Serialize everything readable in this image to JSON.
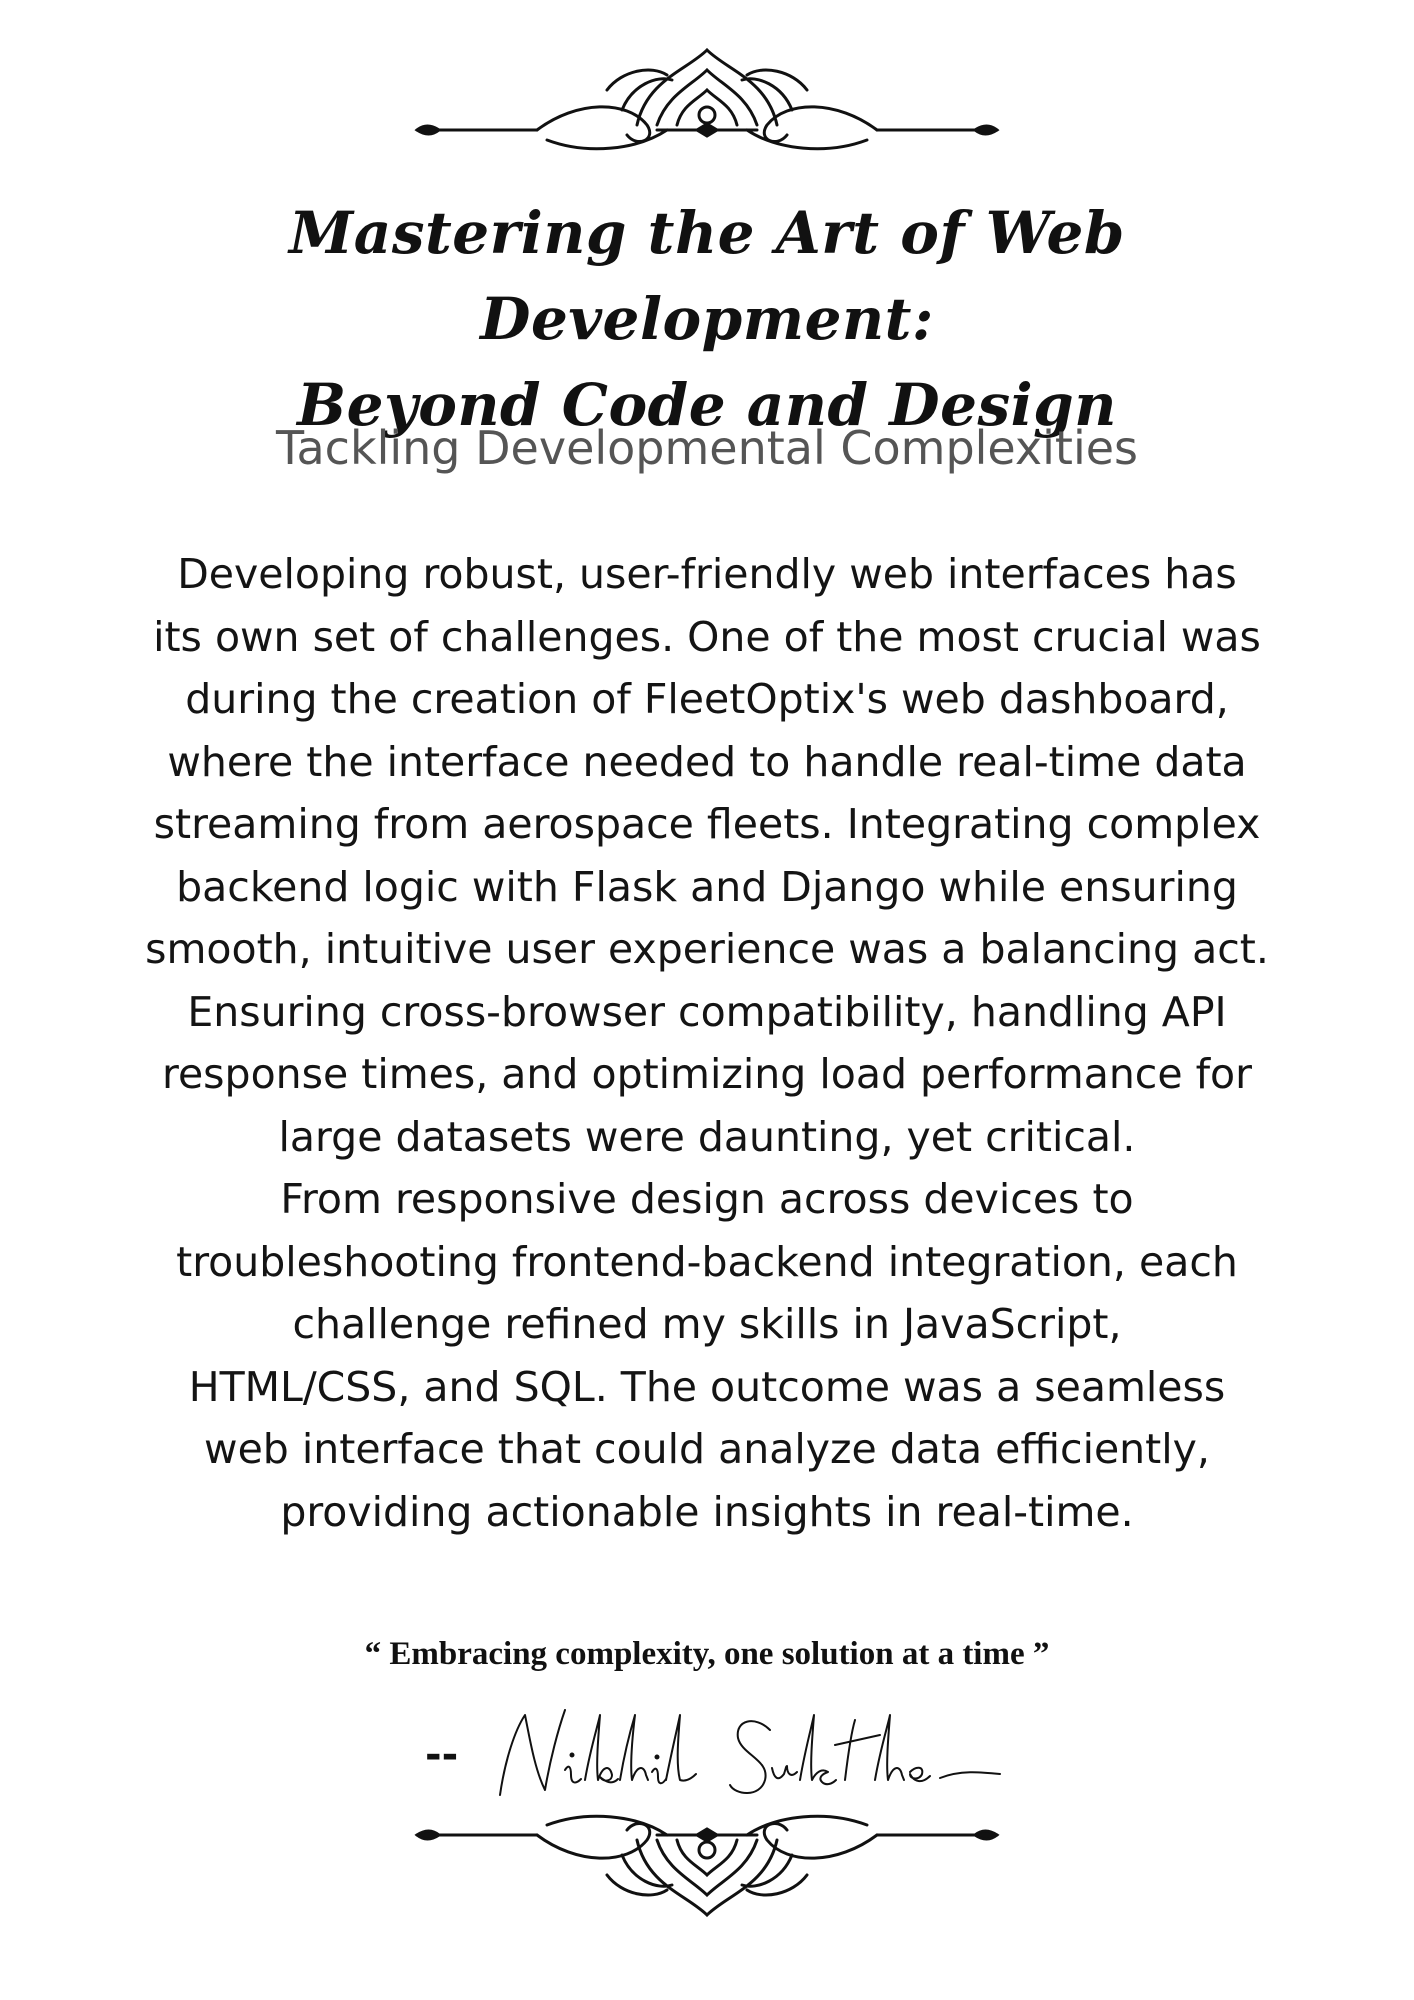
{
  "title": {
    "line1": "Mastering the Art of Web Development:",
    "line2": "Beyond Code and Design"
  },
  "subtitle": "Tackling Developmental Complexities",
  "body_lines": [
    "Developing robust, user-friendly web interfaces has",
    "its own set of challenges. One of the most crucial was",
    "during the creation of FleetOptix's web dashboard,",
    "where the interface needed to handle real-time data",
    "streaming from aerospace fleets. Integrating complex",
    "backend logic with Flask and Django while ensuring",
    "smooth, intuitive user experience was a balancing act.",
    "Ensuring cross-browser compatibility, handling API",
    "response times, and optimizing load performance for",
    "large datasets were daunting, yet critical.",
    "From responsive design across devices to",
    "troubleshooting frontend-backend integration, each",
    "challenge refined my skills in JavaScript,",
    "HTML/CSS, and SQL. The outcome was a seamless",
    "web interface that could analyze data efficiently,",
    "providing actionable insights in real-time."
  ],
  "quote": "“ Embracing complexity, one solution at a time ”",
  "signature": {
    "dash": "--",
    "name": "Nikhil Sukthe"
  },
  "ornament_icon": "flourish-divider-icon"
}
